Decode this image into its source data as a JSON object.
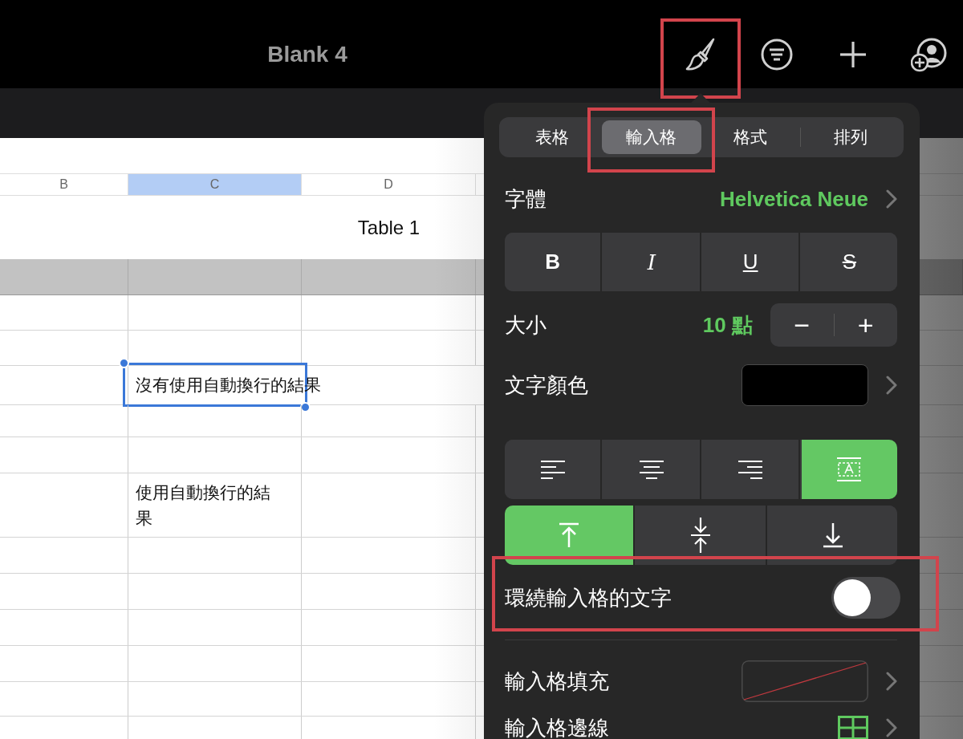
{
  "top_bar": {
    "title": "Blank 4",
    "format_button_highlighted": true
  },
  "sheet": {
    "columns": [
      {
        "label": "B",
        "selected": false
      },
      {
        "label": "C",
        "selected": true
      },
      {
        "label": "D",
        "selected": false
      }
    ],
    "table_title": "Table 1",
    "cells": [
      {
        "text": "沒有使用自動換行的結果",
        "wrap": false,
        "selected": true
      },
      {
        "text": "使用自動換行的結果",
        "wrap": true,
        "selected": false
      }
    ]
  },
  "format_panel": {
    "tabs": [
      {
        "label": "表格",
        "selected": false,
        "highlighted": false
      },
      {
        "label": "輸入格",
        "selected": true,
        "highlighted": true
      },
      {
        "label": "格式",
        "selected": false,
        "highlighted": false
      },
      {
        "label": "排列",
        "selected": false,
        "highlighted": false
      }
    ],
    "rows": [
      {
        "kind": "font",
        "label": "字體",
        "value": "Helvetica Neue"
      },
      {
        "kind": "styles",
        "buttons": [
          {
            "label": "B",
            "on": false
          },
          {
            "label": "I",
            "on": false
          },
          {
            "label": "U",
            "on": false
          },
          {
            "label": "S",
            "on": false
          }
        ]
      },
      {
        "kind": "size",
        "label": "大小",
        "value": "10 點",
        "minus": "−",
        "plus": "+"
      },
      {
        "kind": "color",
        "label": "文字顏色",
        "color": "#000000"
      },
      {
        "kind": "halign",
        "options": [
          {
            "kind": "left",
            "selected": false
          },
          {
            "kind": "center",
            "selected": false
          },
          {
            "kind": "right",
            "selected": false
          },
          {
            "kind": "fit",
            "selected": true
          }
        ]
      },
      {
        "kind": "valign",
        "options": [
          {
            "kind": "top",
            "selected": true
          },
          {
            "kind": "middle",
            "selected": false
          },
          {
            "kind": "bottom",
            "selected": false
          }
        ]
      },
      {
        "kind": "toggle",
        "label": "環繞輸入格的文字",
        "on": false,
        "highlighted": true
      },
      {
        "kind": "fill",
        "label": "輸入格填充"
      },
      {
        "kind": "border",
        "label": "輸入格邊線"
      }
    ]
  }
}
